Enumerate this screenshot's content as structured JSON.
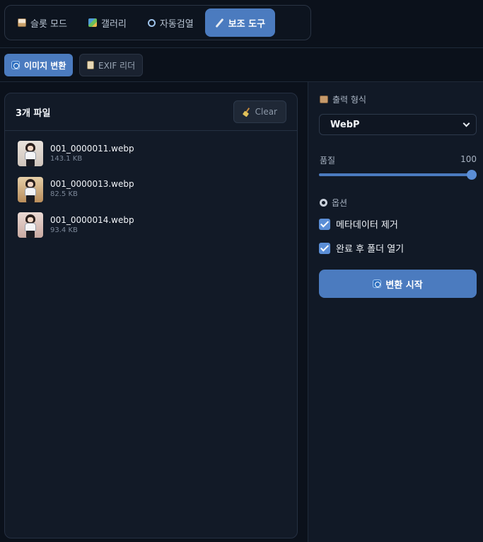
{
  "topnav": {
    "tabs": [
      {
        "label": "슬롯 모드",
        "icon": "slot-icon",
        "active": false
      },
      {
        "label": "갤러리",
        "icon": "gallery-icon",
        "active": false
      },
      {
        "label": "자동검열",
        "icon": "search-icon",
        "active": false
      },
      {
        "label": "보조 도구",
        "icon": "wrench-icon",
        "active": true
      }
    ]
  },
  "subtabs": {
    "convert": "이미지 변환",
    "exif": "EXIF 리더"
  },
  "files": {
    "count_label": "3개 파일",
    "clear_label": "Clear",
    "items": [
      {
        "name": "001_0000011.webp",
        "size": "143.1 KB"
      },
      {
        "name": "001_0000013.webp",
        "size": "82.5 KB"
      },
      {
        "name": "001_0000014.webp",
        "size": "93.4 KB"
      }
    ]
  },
  "settings": {
    "format_label": "출력 형식",
    "format_value": "WebP",
    "quality_label": "품질",
    "quality_value": "100",
    "quality_fraction": 1.0,
    "options_label": "옵션",
    "option_strip_metadata": "메타데이터 제거",
    "option_open_folder": "완료 후 폴더 열기",
    "start_label": "변환 시작"
  },
  "colors": {
    "accent": "#4b7bbf",
    "background": "#0b111b",
    "panel": "#121a27"
  }
}
